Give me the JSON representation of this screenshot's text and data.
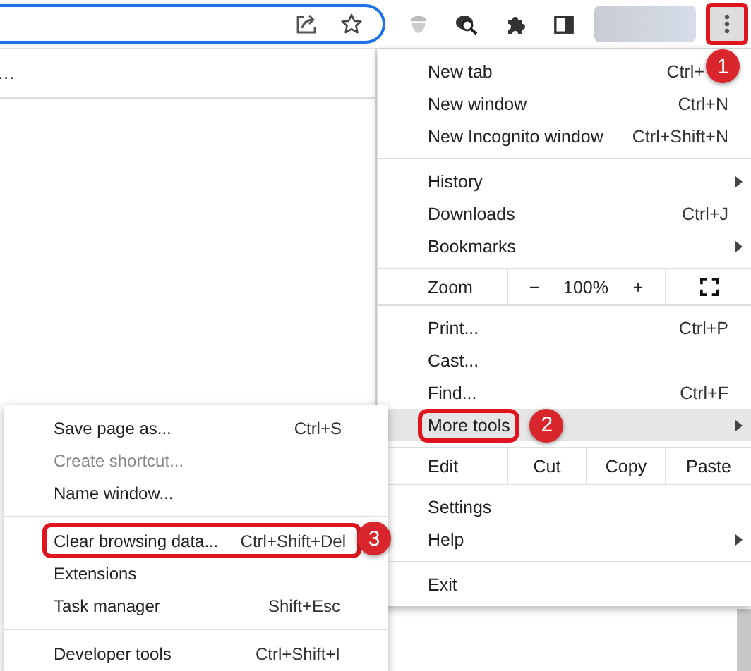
{
  "toolbar": {
    "menu_button": {
      "callout": "1"
    }
  },
  "page": {
    "overflow_text": "…"
  },
  "main_menu": {
    "sections": [
      {
        "kind": "items",
        "items": [
          {
            "label": "New tab",
            "shortcut": "Ctrl+"
          },
          {
            "label": "New window",
            "shortcut": "Ctrl+N"
          },
          {
            "label": "New Incognito window",
            "shortcut": "Ctrl+Shift+N"
          }
        ]
      },
      {
        "kind": "items",
        "items": [
          {
            "label": "History",
            "has_submenu": true
          },
          {
            "label": "Downloads",
            "shortcut": "Ctrl+J"
          },
          {
            "label": "Bookmarks",
            "has_submenu": true
          }
        ]
      },
      {
        "kind": "zoom",
        "label": "Zoom",
        "minus": "−",
        "value": "100%",
        "plus": "+"
      },
      {
        "kind": "items",
        "items": [
          {
            "label": "Print...",
            "shortcut": "Ctrl+P"
          },
          {
            "label": "Cast..."
          },
          {
            "label": "Find...",
            "shortcut": "Ctrl+F"
          },
          {
            "label": "More tools",
            "has_submenu": true,
            "highlighted": true,
            "callout": "2"
          }
        ]
      },
      {
        "kind": "edit",
        "label": "Edit",
        "buttons": [
          "Cut",
          "Copy",
          "Paste"
        ]
      },
      {
        "kind": "items",
        "items": [
          {
            "label": "Settings"
          },
          {
            "label": "Help",
            "has_submenu": true
          }
        ]
      },
      {
        "kind": "items",
        "items": [
          {
            "label": "Exit"
          }
        ]
      }
    ]
  },
  "submenu": {
    "sections": [
      {
        "kind": "items",
        "items": [
          {
            "label": "Save page as...",
            "shortcut": "Ctrl+S"
          },
          {
            "label": "Create shortcut...",
            "disabled": true
          },
          {
            "label": "Name window..."
          }
        ]
      },
      {
        "kind": "items",
        "items": [
          {
            "label": "Clear browsing data...",
            "shortcut": "Ctrl+Shift+Del",
            "callout": "3"
          },
          {
            "label": "Extensions"
          },
          {
            "label": "Task manager",
            "shortcut": "Shift+Esc"
          }
        ]
      },
      {
        "kind": "items",
        "items": [
          {
            "label": "Developer tools",
            "shortcut": "Ctrl+Shift+I"
          }
        ]
      }
    ]
  }
}
